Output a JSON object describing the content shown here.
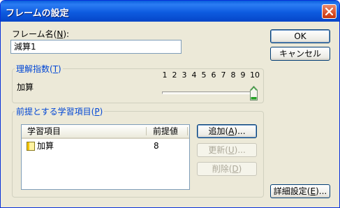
{
  "window": {
    "title": "フレームの設定",
    "close_icon": "close-icon"
  },
  "frame_name": {
    "label": "フレーム名(",
    "mnemonic": "N",
    "label_end": "):",
    "value": "減算1"
  },
  "buttons": {
    "ok": "OK",
    "cancel": "キャンセル",
    "add": "追加(",
    "add_mnemonic": "A",
    "add_end": ")...",
    "update": "更新(",
    "update_mnemonic": "U",
    "update_end": ")...",
    "delete": "削除(",
    "delete_mnemonic": "D",
    "delete_end": ")",
    "details": "詳細設定(",
    "details_mnemonic": "E",
    "details_end": ")..."
  },
  "comprehension": {
    "title": "理解指数(",
    "mnemonic": "T",
    "title_end": ")",
    "item_label": "加算",
    "ticks": [
      "1",
      "2",
      "3",
      "4",
      "5",
      "6",
      "7",
      "8",
      "9",
      "10"
    ],
    "slider_value": 10,
    "slider_min": 1,
    "slider_max": 10
  },
  "prerequisites": {
    "title": "前提とする学習項目(",
    "mnemonic": "P",
    "title_end": ")",
    "columns": [
      "学習項目",
      "前提値"
    ],
    "rows": [
      {
        "item": "加算",
        "value": "8",
        "icon": "note-icon"
      }
    ]
  },
  "colors": {
    "titlebar": "#0a5fdc",
    "dialog_bg": "#ece9d8",
    "group_title": "#0046d5",
    "close_button": "#d9512c",
    "slider_thumb": "#21a121"
  }
}
